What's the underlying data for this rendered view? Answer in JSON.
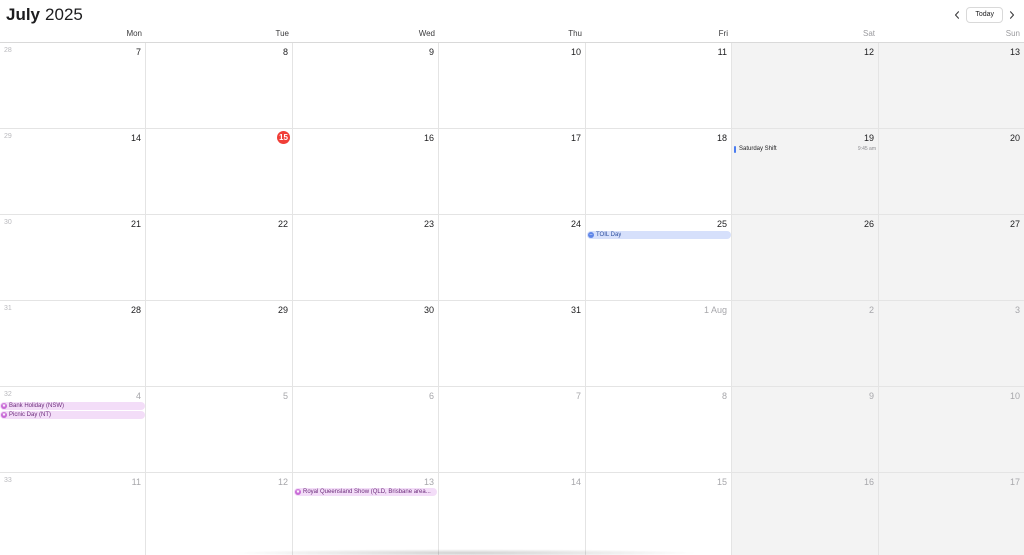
{
  "header": {
    "month": "July",
    "year": "2025",
    "today_label": "Today",
    "prev_icon": "chevron-left-icon",
    "next_icon": "chevron-right-icon"
  },
  "weekdays": [
    "Mon",
    "Tue",
    "Wed",
    "Thu",
    "Fri",
    "Sat",
    "Sun"
  ],
  "colors": {
    "today": "#f03e37",
    "holiday_bg": "#f3ddf8",
    "holiday_icon": "#c86ad6",
    "toil_bg": "#d6e0fb",
    "toil_icon": "#5f86e8",
    "shift_bar": "#4a7cf0",
    "weekend_bg": "#f3f3f3"
  },
  "weeks": [
    {
      "week_number": "28",
      "days": [
        "7",
        "8",
        "9",
        "10",
        "11",
        "12",
        "13"
      ]
    },
    {
      "week_number": "29",
      "days": [
        "14",
        "15",
        "16",
        "17",
        "18",
        "19",
        "20"
      ]
    },
    {
      "week_number": "30",
      "days": [
        "21",
        "22",
        "23",
        "24",
        "25",
        "26",
        "27"
      ]
    },
    {
      "week_number": "31",
      "days": [
        "28",
        "29",
        "30",
        "31",
        "1 Aug",
        "2",
        "3"
      ]
    },
    {
      "week_number": "32",
      "days": [
        "4",
        "5",
        "6",
        "7",
        "8",
        "9",
        "10"
      ]
    },
    {
      "week_number": "33",
      "days": [
        "11",
        "12",
        "13",
        "14",
        "15",
        "16",
        "17"
      ]
    }
  ],
  "events": {
    "saturday_shift": {
      "title": "Saturday Shift",
      "time": "9:45 am"
    },
    "toil_day": {
      "title": "TOIL Day"
    },
    "bank_holiday": {
      "title": "Bank Holiday (NSW)"
    },
    "picnic_day": {
      "title": "Picnic Day (NT)"
    },
    "royal_show": {
      "title": "Royal Queensland Show (QLD, Brisbane area..."
    }
  }
}
